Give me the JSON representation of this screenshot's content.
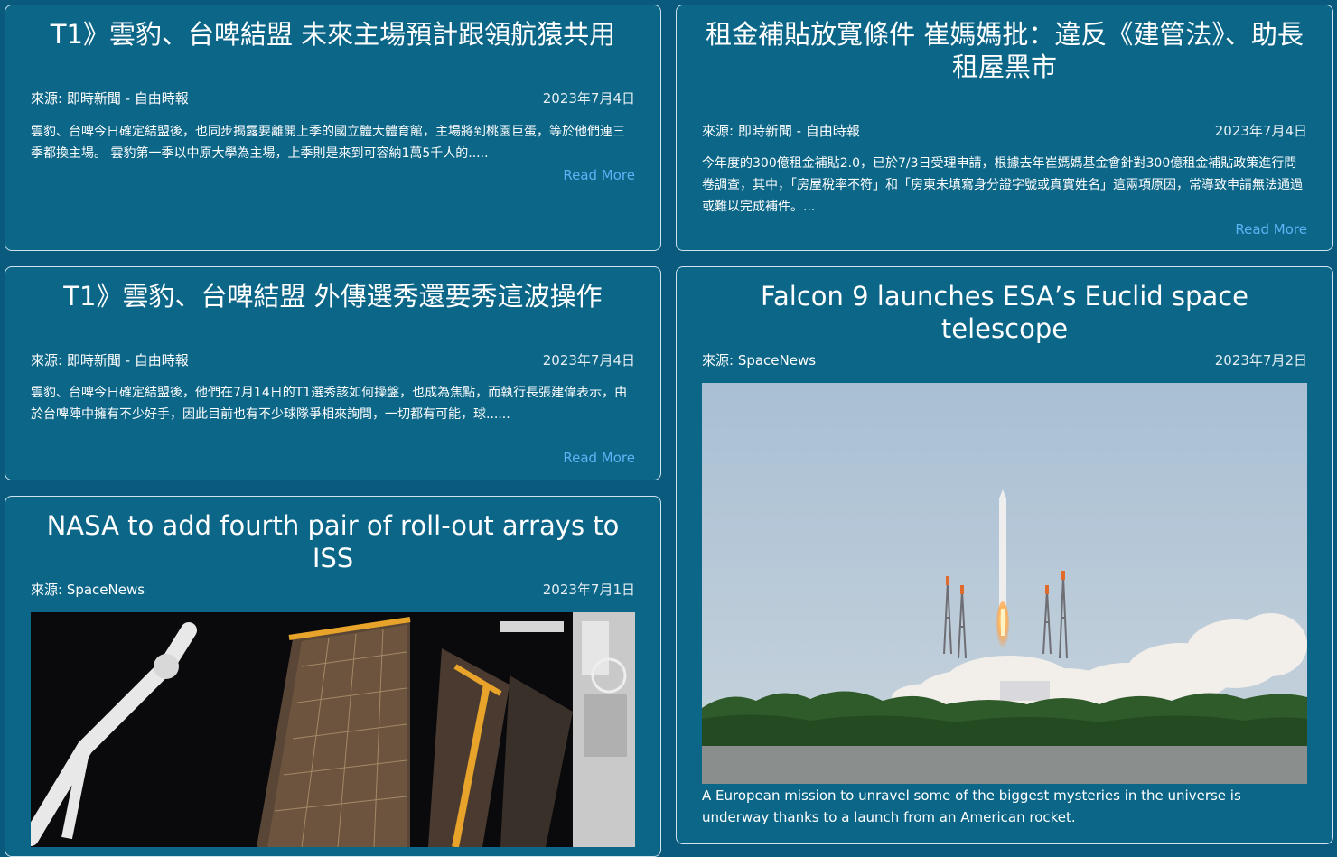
{
  "cards": [
    {
      "title": "T1》雲豹、台啤結盟 未來主場預計跟領航猿共用",
      "source": "來源: 即時新聞 - 自由時報",
      "date": "2023年7月4日",
      "excerpt": "雲豹、台啤今日確定結盟後，也同步揭露要離開上季的國立體大體育館，主場將到桃園巨蛋，等於他們連三季都換主場。 雲豹第一季以中原大學為主場，上季則是來到可容納1萬5千人的.....",
      "read_more": "Read More"
    },
    {
      "title": "租金補貼放寬條件 崔媽媽批：違反《建管法》、助長租屋黑市",
      "source": "來源: 即時新聞 - 自由時報",
      "date": "2023年7月4日",
      "excerpt": "今年度的300億租金補貼2.0，已於7/3日受理申請，根據去年崔媽媽基金會針對300億租金補貼政策進行問卷調查，其中，「房屋稅率不符」和「房東未填寫身分證字號或真實姓名」這兩項原因，常導致申請無法通過或難以完成補件。...",
      "read_more": "Read More"
    },
    {
      "title": "T1》雲豹、台啤結盟 外傳選秀還要秀這波操作",
      "source": "來源: 即時新聞 - 自由時報",
      "date": "2023年7月4日",
      "excerpt": "雲豹、台啤今日確定結盟後，他們在7月14日的T1選秀該如何操盤，也成為焦點，而執行長張建偉表示，由於台啤陣中擁有不少好手，因此目前也有不少球隊爭相來詢問，一切都有可能，球......",
      "read_more": "Read More"
    },
    {
      "title": "Falcon 9 launches ESA’s Euclid space telescope",
      "source": "來源: SpaceNews",
      "date": "2023年7月2日",
      "caption": "A European mission to unravel some of the biggest mysteries in the universe is underway thanks to a launch from an American rocket."
    },
    {
      "title": "NASA to add fourth pair of roll-out arrays to ISS",
      "source": "來源: SpaceNews",
      "date": "2023年7月1日"
    }
  ],
  "colors": {
    "background": "#0a5a7e",
    "card": "#0b6688",
    "link": "#5ab4f5"
  }
}
